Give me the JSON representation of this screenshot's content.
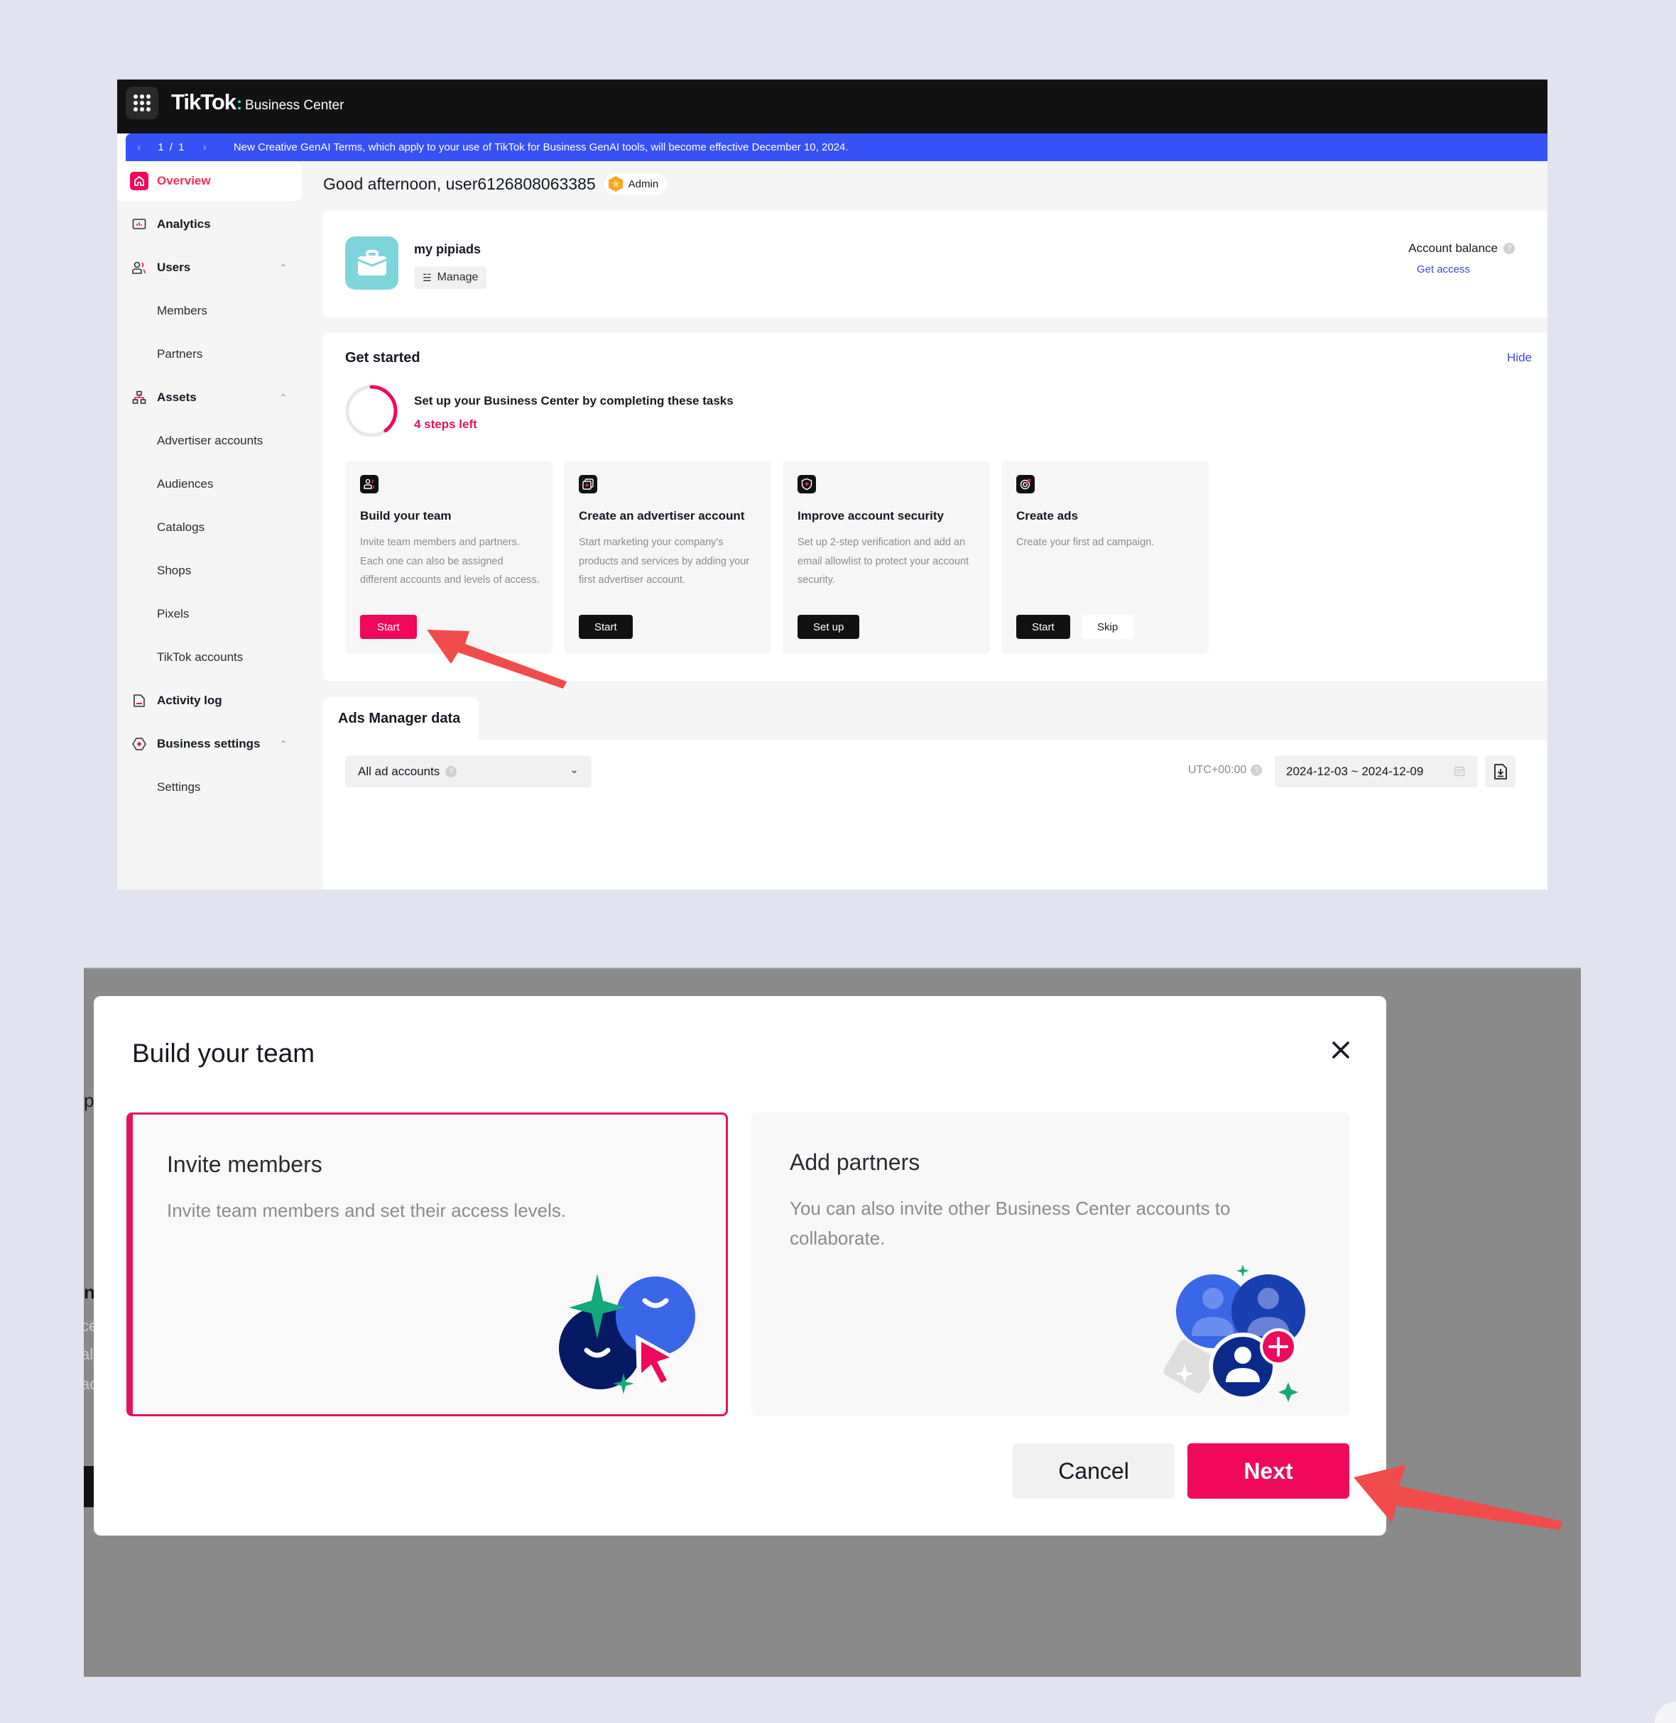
{
  "app": {
    "brand": "TikTok",
    "product": "Business Center"
  },
  "banner": {
    "prev_icon": "chevron-left-icon",
    "pager": "1 / 1",
    "next_icon": "chevron-right-icon",
    "message": "New Creative GenAI Terms, which apply to your use of TikTok for Business GenAI tools, will become effective December 10, 2024."
  },
  "sidebar": {
    "items": [
      {
        "label": "Overview",
        "icon": "home-icon",
        "active": true
      },
      {
        "label": "Analytics",
        "icon": "analytics-icon"
      },
      {
        "label": "Users",
        "icon": "users-icon",
        "expanded": true
      },
      {
        "label": "Members"
      },
      {
        "label": "Partners"
      },
      {
        "label": "Assets",
        "icon": "assets-icon",
        "expanded": true
      },
      {
        "label": "Advertiser accounts"
      },
      {
        "label": "Audiences"
      },
      {
        "label": "Catalogs"
      },
      {
        "label": "Shops"
      },
      {
        "label": "Pixels"
      },
      {
        "label": "TikTok accounts"
      },
      {
        "label": "Activity log",
        "icon": "document-icon"
      },
      {
        "label": "Business settings",
        "icon": "settings-hex-icon",
        "expanded": true
      },
      {
        "label": "Settings"
      }
    ]
  },
  "greeting": {
    "text": "Good afternoon, user6126808063385",
    "role_badge": "Admin"
  },
  "account": {
    "name": "my pipiads",
    "manage_label": "Manage",
    "balance_label": "Account balance",
    "balance_link": "Get access"
  },
  "get_started": {
    "title": "Get started",
    "hide_label": "Hide",
    "heading": "Set up your Business Center by completing these tasks",
    "steps_left": "4 steps left",
    "progress_fraction": 0.4,
    "tasks": [
      {
        "title": "Build your team",
        "description": "Invite team members and partners. Each one can also be assigned different accounts and levels of access.",
        "button": "Start",
        "icon": "team-icon",
        "highlighted": true
      },
      {
        "title": "Create an advertiser account",
        "description": "Start marketing your company's products and services by adding your first advertiser account.",
        "button": "Start",
        "icon": "advertiser-account-icon"
      },
      {
        "title": "Improve account security",
        "description": "Set up 2-step verification and add an email allowlist to protect your account security.",
        "button": "Set up",
        "icon": "shield-icon"
      },
      {
        "title": "Create ads",
        "description": "Create your first ad campaign.",
        "button": "Start",
        "secondary_button": "Skip",
        "icon": "target-icon"
      }
    ]
  },
  "ads_manager": {
    "tab_label": "Ads Manager data",
    "account_select": "All ad accounts",
    "timezone": "UTC+00:00",
    "date_range": "2024-12-03 ~ 2024-12-09"
  },
  "modal": {
    "title": "Build your team",
    "options": [
      {
        "title": "Invite members",
        "description": "Invite team members and set their access levels.",
        "selected": true
      },
      {
        "title": "Add partners",
        "description": "You can also invite other Business Center accounts to collaborate.",
        "selected": false
      }
    ],
    "cancel_label": "Cancel",
    "next_label": "Next"
  },
  "colors": {
    "accent": "#f0085a",
    "banner": "#3651f5",
    "topbar": "#121212",
    "link": "#3949d8",
    "annotation_arrow": "#f24b4b",
    "canvas": "#e1e3f0"
  },
  "background_peek": {
    "chars": [
      "p",
      "n",
      "ce",
      "al",
      "ac"
    ]
  }
}
